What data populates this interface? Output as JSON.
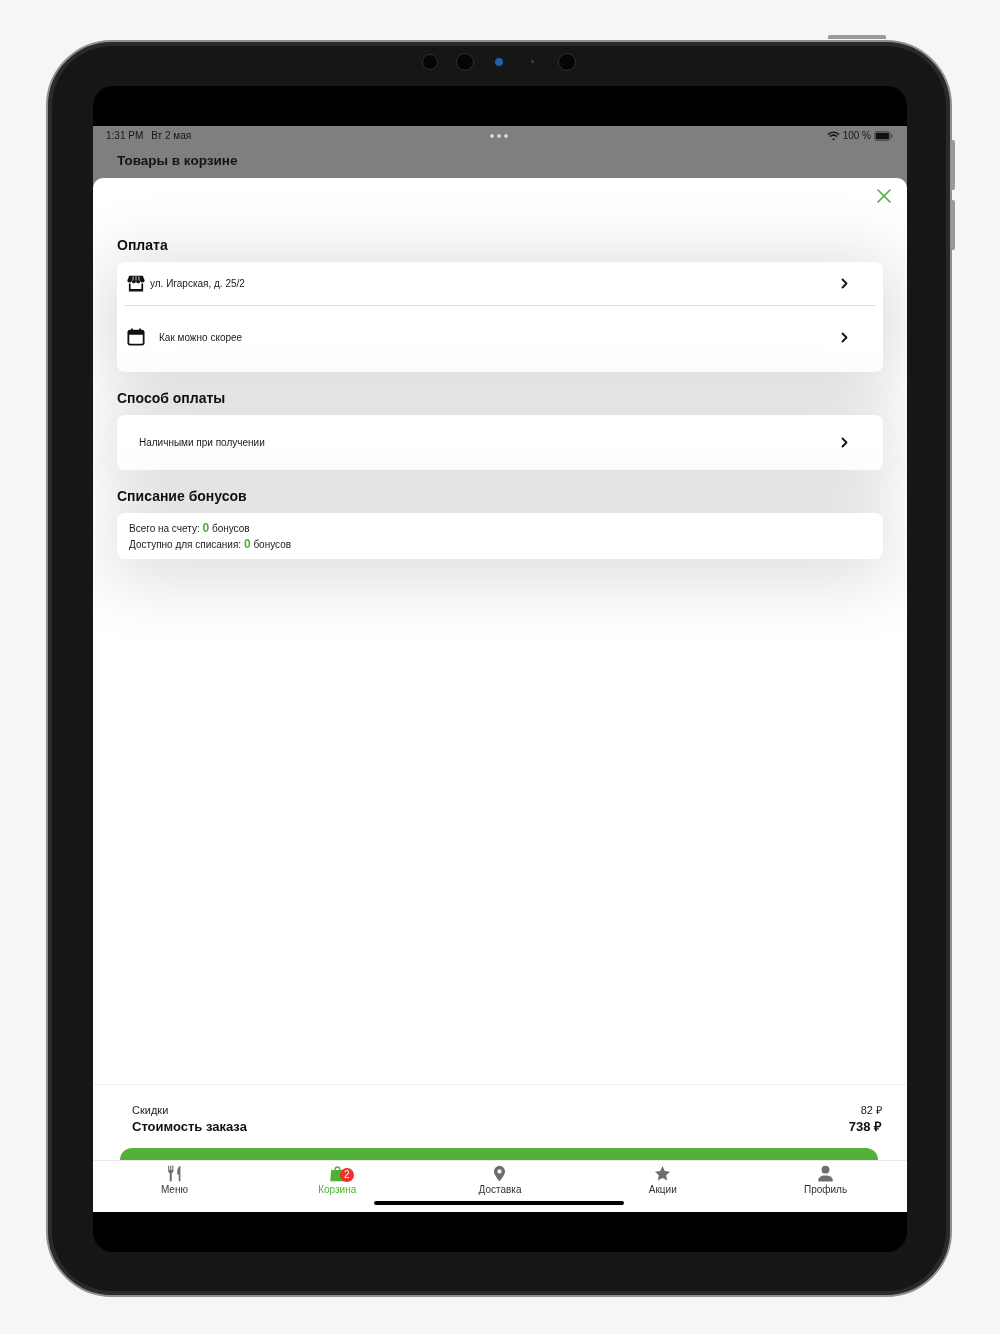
{
  "status_bar": {
    "time": "1:31 PM",
    "date": "Вт 2 мая",
    "battery": "100 %"
  },
  "header": {
    "title": "Товары в корзине"
  },
  "sheet": {
    "sections": [
      {
        "kind": "rows",
        "title": "Оплата",
        "rows": [
          {
            "kind": "store",
            "text": "ул. Игарская, д. 25/2"
          },
          {
            "kind": "calendar",
            "text": "Как можно скорее"
          }
        ]
      },
      {
        "kind": "rows",
        "title": "Способ оплаты",
        "rows": [
          {
            "kind": "plain",
            "text": "Наличными при получении"
          }
        ]
      },
      {
        "kind": "lines",
        "title": "Списание бонусов",
        "lines": [
          "Всего на счету: **0** бонусов",
          "Доступно для списания: **0** бонусов"
        ]
      }
    ]
  },
  "totals": [
    {
      "kind": "regular",
      "label": "Скидки",
      "value": "82 ₽"
    },
    {
      "kind": "total",
      "label": "Стоимость заказа",
      "value": "738 ₽"
    }
  ],
  "tab_bar": {
    "items": [
      {
        "kind": "menu",
        "label": "Меню",
        "selected": false
      },
      {
        "kind": "cart",
        "label": "Корзина",
        "selected": true,
        "badge": "2"
      },
      {
        "kind": "delivery",
        "label": "Доставка",
        "selected": false
      },
      {
        "kind": "promo",
        "label": "Акции",
        "selected": false
      },
      {
        "kind": "profile",
        "label": "Профиль",
        "selected": false
      }
    ]
  }
}
